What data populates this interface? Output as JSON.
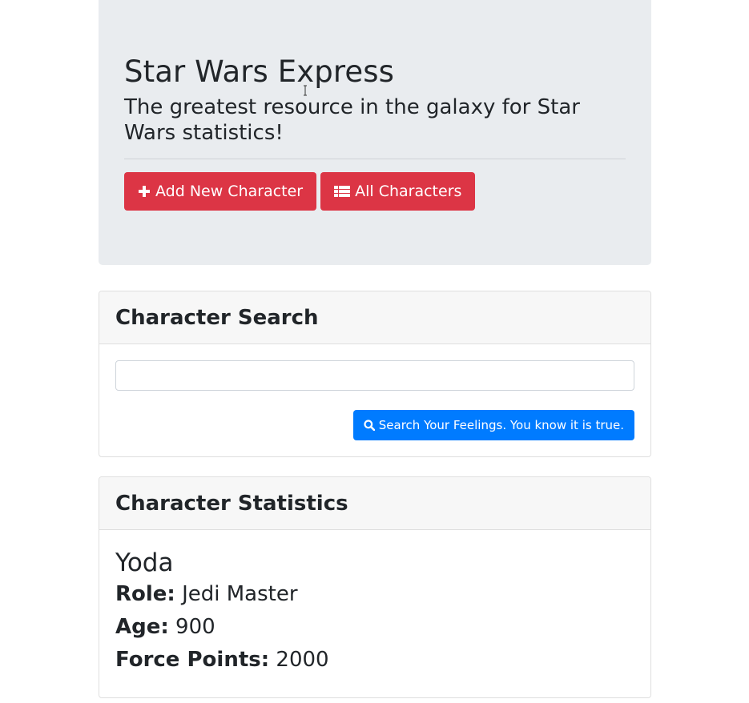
{
  "header": {
    "title": "Star Wars Express",
    "subtitle": "The greatest resource in the galaxy for Star Wars statistics!",
    "buttons": {
      "add_label": "Add New Character",
      "all_label": "All Characters"
    }
  },
  "search": {
    "heading": "Character Search",
    "input_value": "",
    "button_label": "Search Your Feelings. You know it is true."
  },
  "stats": {
    "heading": "Character Statistics",
    "name": "Yoda",
    "role_label": "Role:",
    "role_value": "Jedi Master",
    "age_label": "Age:",
    "age_value": "900",
    "force_label": "Force Points:",
    "force_value": "2000"
  },
  "colors": {
    "danger": "#dc3545",
    "primary": "#007bff",
    "jumbotron_bg": "#e9ecef"
  },
  "icons": {
    "add": "plus-icon",
    "all": "list-icon",
    "search": "search-icon"
  }
}
